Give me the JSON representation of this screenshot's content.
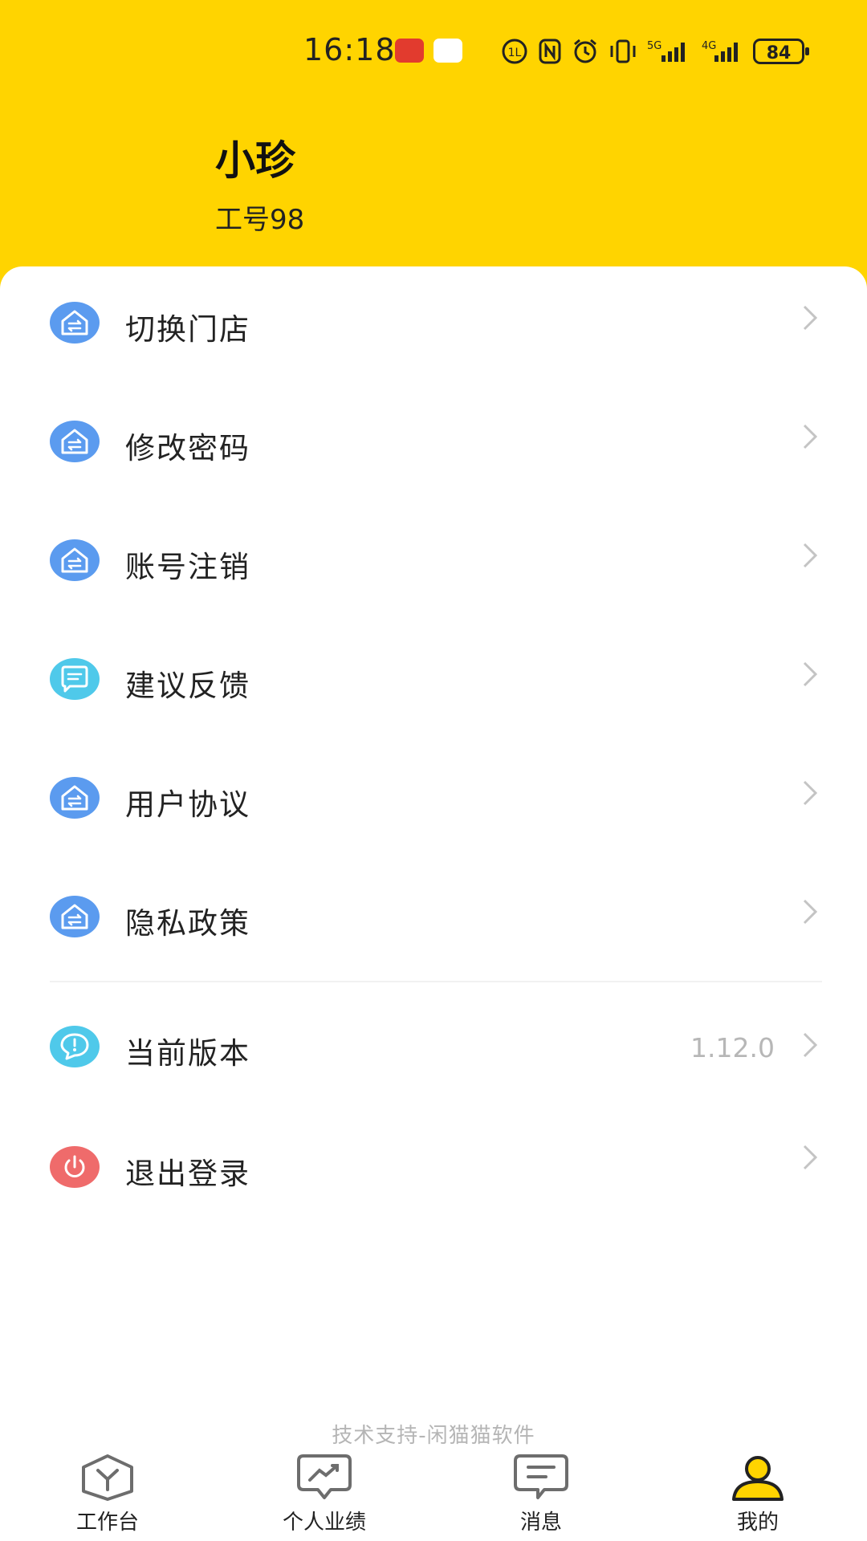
{
  "status_bar": {
    "time": "16:18",
    "battery": "84"
  },
  "profile": {
    "name": "小珍",
    "employee_id": "工号98"
  },
  "menu": {
    "items": [
      {
        "label": "切换门店",
        "icon": "store-swap-icon",
        "color": "#5B9BEF"
      },
      {
        "label": "修改密码",
        "icon": "store-swap-icon",
        "color": "#5B9BEF"
      },
      {
        "label": "账号注销",
        "icon": "store-swap-icon",
        "color": "#5B9BEF"
      },
      {
        "label": "建议反馈",
        "icon": "feedback-chat-icon",
        "color": "#4FC9EA"
      },
      {
        "label": "用户协议",
        "icon": "store-swap-icon",
        "color": "#5B9BEF"
      },
      {
        "label": "隐私政策",
        "icon": "store-swap-icon",
        "color": "#5B9BEF"
      }
    ],
    "version": {
      "label": "当前版本",
      "value": "1.12.0",
      "icon": "info-chat-icon",
      "color": "#4FC9EA"
    },
    "logout": {
      "label": "退出登录",
      "icon": "power-icon",
      "color": "#EF6B6B"
    }
  },
  "footer": {
    "support_text": "技术支持-闲猫猫软件"
  },
  "tabbar": {
    "tabs": [
      {
        "label": "工作台",
        "icon": "workbench-icon"
      },
      {
        "label": "个人业绩",
        "icon": "performance-icon"
      },
      {
        "label": "消息",
        "icon": "message-icon"
      },
      {
        "label": "我的",
        "icon": "profile-icon",
        "active": true
      }
    ]
  },
  "colors": {
    "header": "#FFD400",
    "active_tab": "#FFD400"
  }
}
